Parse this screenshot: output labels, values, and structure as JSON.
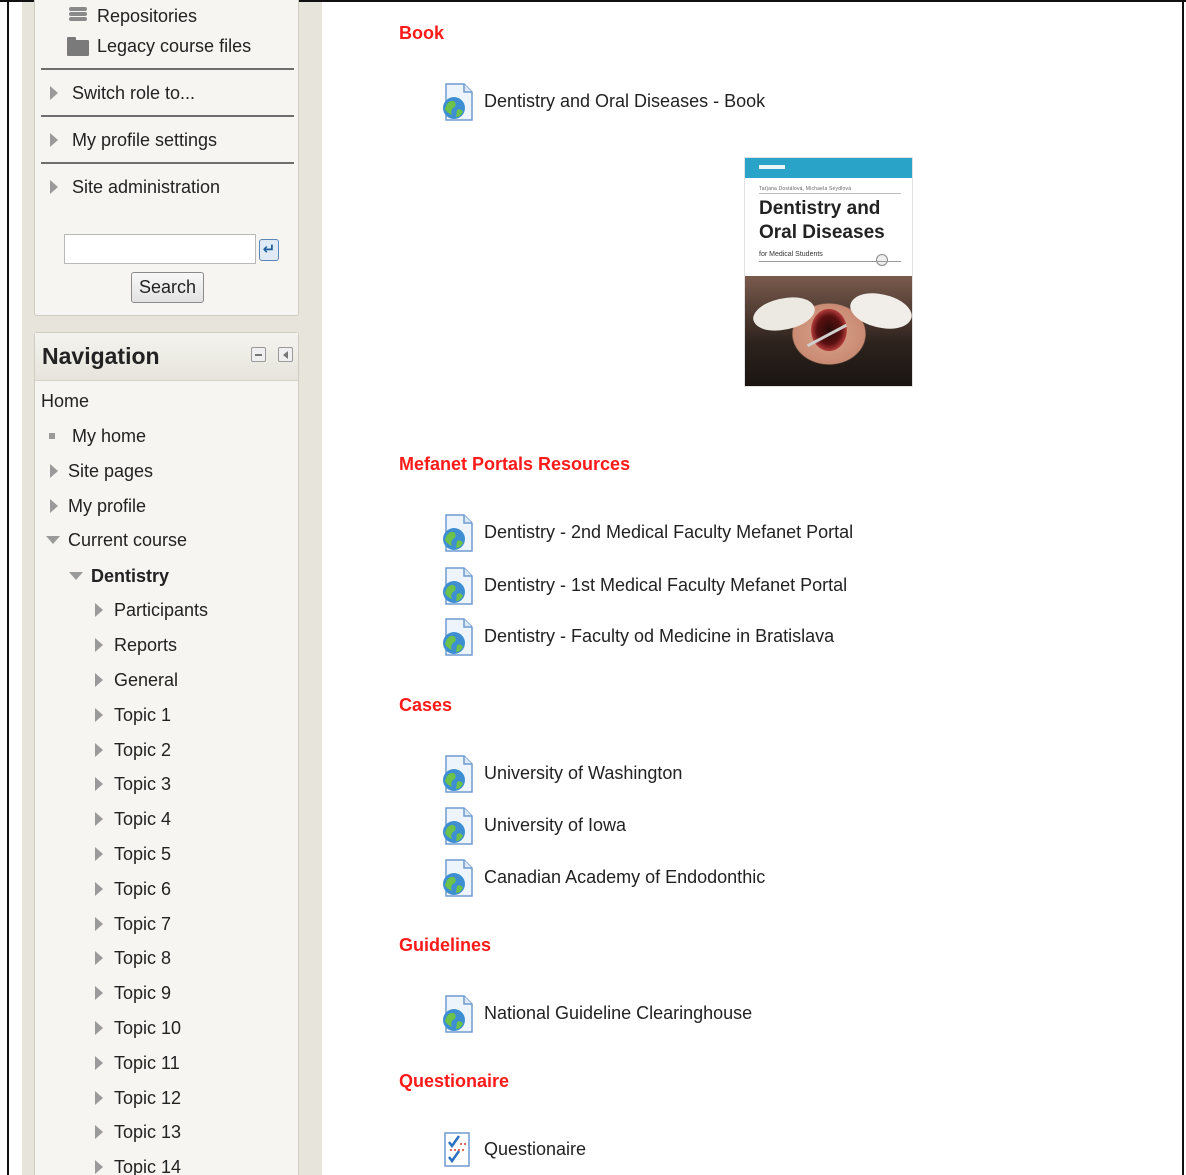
{
  "sidebar": {
    "settings": {
      "repositories": "Repositories",
      "legacy_course_files": "Legacy course files",
      "switch_role": "Switch role to...",
      "my_profile_settings": "My profile settings",
      "site_administration": "Site administration",
      "search_button": "Search",
      "search_value": ""
    },
    "navigation": {
      "title": "Navigation",
      "home": "Home",
      "my_home": "My home",
      "site_pages": "Site pages",
      "my_profile": "My profile",
      "current_course": "Current course",
      "course_name": "Dentistry",
      "course_items": [
        "Participants",
        "Reports",
        "General",
        "Topic 1",
        "Topic 2",
        "Topic 3",
        "Topic 4",
        "Topic 5",
        "Topic 6",
        "Topic 7",
        "Topic 8",
        "Topic 9",
        "Topic 10",
        "Topic 11",
        "Topic 12",
        "Topic 13",
        "Topic 14"
      ]
    }
  },
  "main": {
    "sections": [
      {
        "heading": "Book",
        "links": [
          "Dentistry and Oral Diseases - Book"
        ]
      },
      {
        "heading": "Mefanet Portals Resources",
        "links": [
          "Dentistry - 2nd Medical Faculty Mefanet Portal",
          "Dentistry - 1st Medical Faculty Mefanet Portal",
          "Dentistry - Faculty od Medicine in Bratislava"
        ]
      },
      {
        "heading": "Cases",
        "links": [
          "University of Washington",
          "University of Iowa",
          "Canadian Academy of Endodonthic"
        ]
      },
      {
        "heading": "Guidelines",
        "links": [
          "National Guideline Clearinghouse"
        ]
      },
      {
        "heading": "Questionaire",
        "links": [
          "Questionaire"
        ]
      }
    ],
    "book_cover": {
      "authors": "Taťjana Dostálová, Michaela Seydlová",
      "title_line1": "Dentistry and",
      "title_line2": "Oral Diseases",
      "subtitle": "for Medical Students"
    },
    "colors": {
      "section_heading": "#ff1a1a",
      "sidebar_bg": "#e7e4db",
      "block_bg": "#f6f5f1"
    }
  }
}
